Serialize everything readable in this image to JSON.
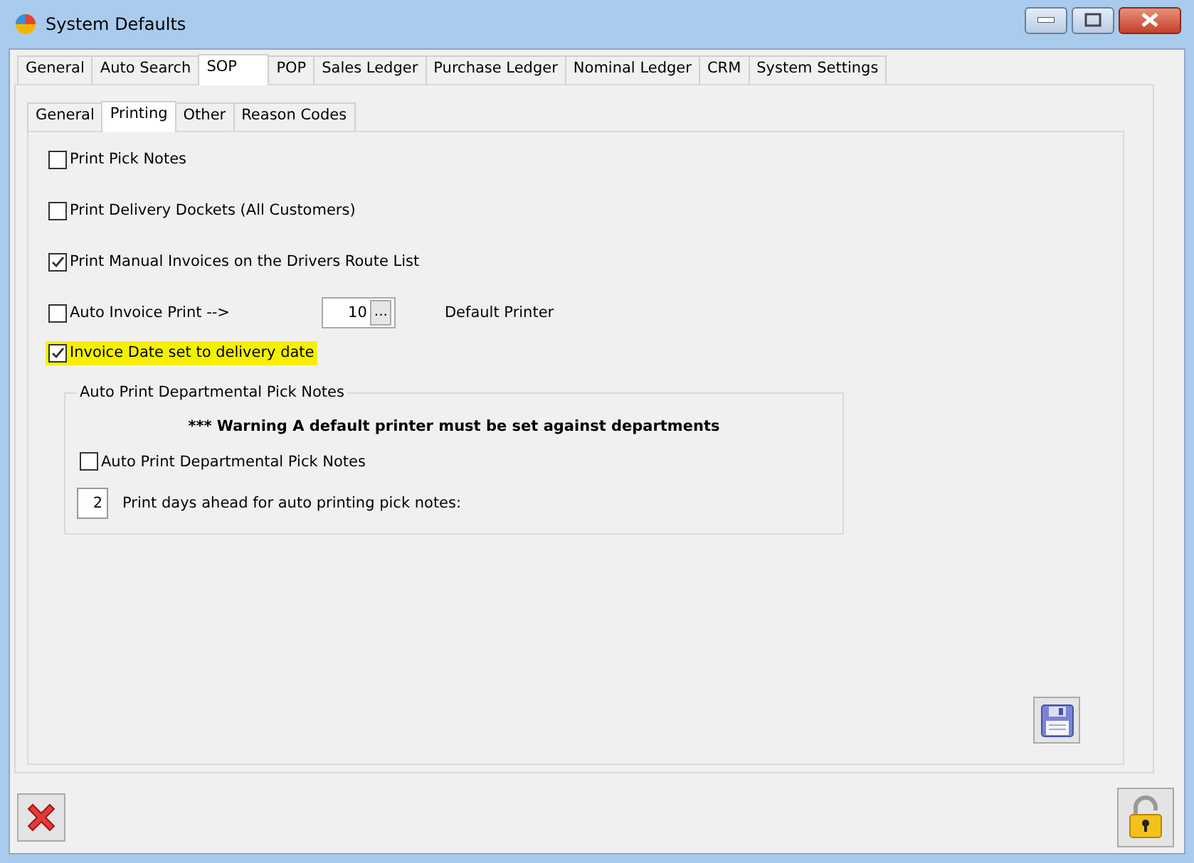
{
  "window": {
    "title": "System Defaults"
  },
  "tabs": [
    {
      "label": "General",
      "selected": false
    },
    {
      "label": "Auto Search",
      "selected": false
    },
    {
      "label": "SOP",
      "selected": true
    },
    {
      "label": "POP",
      "selected": false
    },
    {
      "label": "Sales Ledger",
      "selected": false
    },
    {
      "label": "Purchase Ledger",
      "selected": false
    },
    {
      "label": "Nominal Ledger",
      "selected": false
    },
    {
      "label": "CRM",
      "selected": false
    },
    {
      "label": "System Settings",
      "selected": false
    }
  ],
  "sub_tabs": [
    {
      "label": "General",
      "selected": false
    },
    {
      "label": "Printing",
      "selected": true
    },
    {
      "label": "Other",
      "selected": false
    },
    {
      "label": "Reason Codes",
      "selected": false
    }
  ],
  "options": [
    {
      "kind": "checkbox",
      "label": "Print Pick Notes",
      "checked": false,
      "highlighted": false
    },
    {
      "kind": "checkbox",
      "label": "Print Delivery Dockets (All Customers)",
      "checked": false,
      "highlighted": false
    },
    {
      "kind": "checkbox",
      "label": "Print Manual Invoices on the Drivers Route List",
      "checked": true,
      "highlighted": false
    },
    {
      "kind": "printer",
      "label": "Auto Invoice Print -->",
      "checked": false,
      "highlighted": false,
      "value": "10",
      "button": "...",
      "printer": "Default Printer"
    },
    {
      "kind": "checkbox",
      "label": "Invoice Date set to delivery date",
      "checked": true,
      "highlighted": true
    }
  ],
  "group": {
    "title": "Auto Print Departmental Pick Notes",
    "warning": "*** Warning A default printer must be set against departments",
    "checkbox": {
      "label": "Auto Print Departmental Pick Notes",
      "checked": false
    },
    "days_value": "2",
    "days_label": "Print days ahead for auto printing pick notes:"
  }
}
